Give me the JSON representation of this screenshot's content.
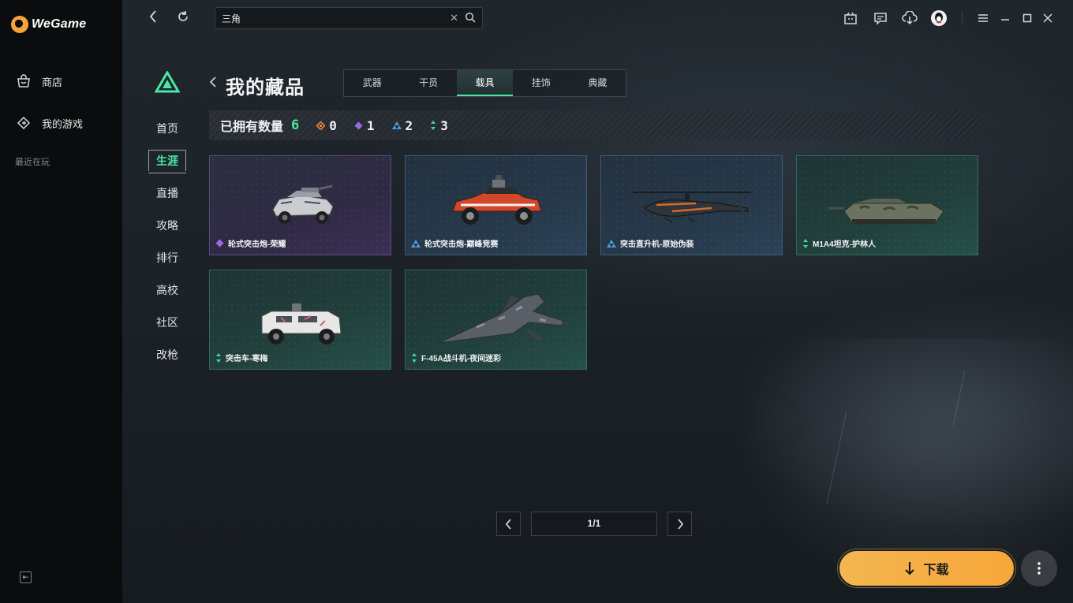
{
  "app": {
    "name": "WeGame"
  },
  "sidebar": {
    "items": [
      {
        "label": "商店",
        "icon": "store-bag-icon"
      },
      {
        "label": "我的游戏",
        "icon": "my-games-icon"
      }
    ],
    "recent_label": "最近在玩"
  },
  "topbar": {
    "search": {
      "value": "三角"
    }
  },
  "game_nav": {
    "items": [
      "首页",
      "生涯",
      "直播",
      "攻略",
      "排行",
      "高校",
      "社区",
      "改枪"
    ],
    "active": "生涯"
  },
  "header": {
    "title": "我的藏品",
    "tabs": [
      "武器",
      "干员",
      "载具",
      "挂饰",
      "典藏"
    ],
    "active_tab": "载具"
  },
  "stats": {
    "label": "已拥有数量",
    "total": "6",
    "counts": [
      {
        "rarity": "orange",
        "color": "#e8833a",
        "value": "0"
      },
      {
        "rarity": "purple",
        "color": "#9b6ae6",
        "value": "1"
      },
      {
        "rarity": "blue",
        "color": "#4d9de0",
        "value": "2"
      },
      {
        "rarity": "green",
        "color": "#3fd9a0",
        "value": "3"
      }
    ]
  },
  "items": [
    {
      "name": "轮式突击炮-荣耀",
      "rarity": "purple",
      "art": "armored-car-icon"
    },
    {
      "name": "轮式突击炮-巅峰竞赛",
      "rarity": "blue",
      "art": "red-assault-vehicle-icon"
    },
    {
      "name": "突击直升机-原始伪装",
      "rarity": "blue",
      "art": "helicopter-icon"
    },
    {
      "name": "M1A4坦克-护林人",
      "rarity": "green",
      "art": "tank-icon"
    },
    {
      "name": "突击车-寒梅",
      "rarity": "green",
      "art": "armored-truck-icon"
    },
    {
      "name": "F-45A战斗机-夜间迷彩",
      "rarity": "green",
      "art": "fighter-jet-icon"
    }
  ],
  "pager": {
    "page": "1/1"
  },
  "actions": {
    "download": "下载"
  },
  "colors": {
    "accent": "#4ce6a4",
    "download": "#f6ae45"
  }
}
